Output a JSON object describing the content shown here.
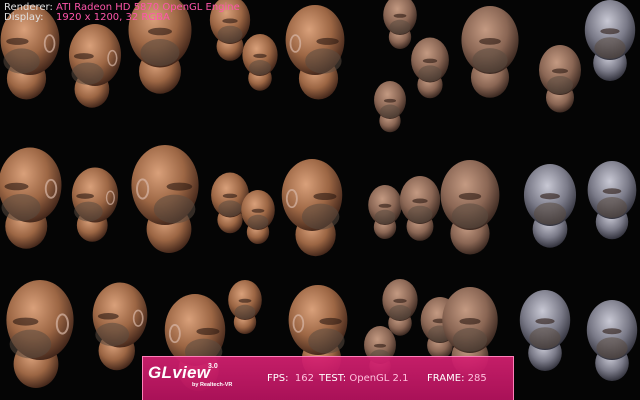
{
  "info": {
    "renderer_label": "Renderer:",
    "renderer_value": "ATI Radeon HD 5870 OpenGL Engine",
    "display_label": "Display:",
    "display_value": "1920 x 1200, 32 RGBA"
  },
  "hud": {
    "logo_name": "GLview",
    "logo_version": "3.0",
    "logo_by": "by Realtech-VR",
    "fps_label": "FPS:",
    "fps_value": "162",
    "test_label": "TEST:",
    "test_value": "OpenGL 2.1",
    "frame_label": "FRAME:",
    "frame_value": "285"
  },
  "colors": {
    "hud_bg": "#c8186e",
    "info_value": "#ff55aa",
    "skin_warm": "#b07850",
    "skin_cool": "#8c8c9a"
  },
  "scene": {
    "subject": "rendered-head-model"
  }
}
